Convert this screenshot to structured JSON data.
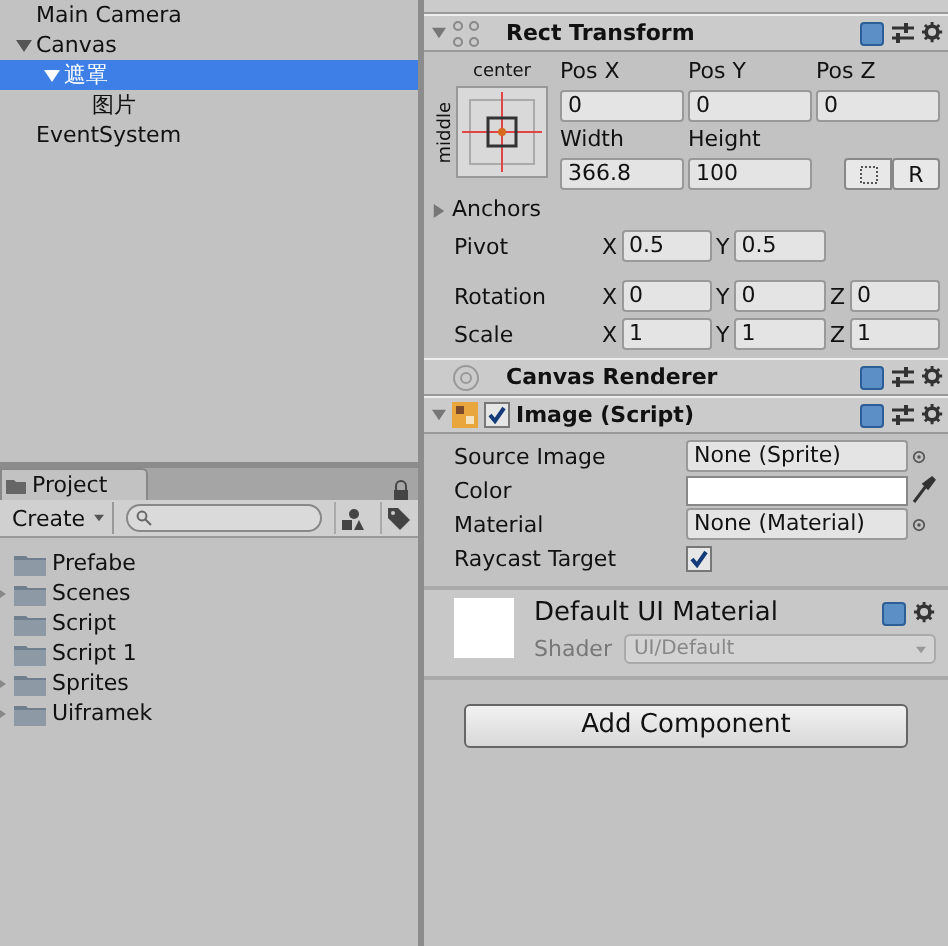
{
  "hierarchy": {
    "items": [
      {
        "label": "Main Camera",
        "selected": false
      },
      {
        "label": "Canvas",
        "selected": false,
        "expanded": true,
        "children": [
          {
            "label": "遮罩",
            "selected": true,
            "expanded": true,
            "children": [
              {
                "label": "图片",
                "selected": false
              }
            ]
          }
        ]
      },
      {
        "label": "EventSystem",
        "selected": false
      }
    ]
  },
  "project": {
    "tab": "Project",
    "create": "Create",
    "folders": [
      {
        "label": "Prefabe",
        "expandable": false
      },
      {
        "label": "Scenes",
        "expandable": true
      },
      {
        "label": "Script",
        "expandable": false
      },
      {
        "label": "Script 1",
        "expandable": false
      },
      {
        "label": "Sprites",
        "expandable": true
      },
      {
        "label": "Uiframek",
        "expandable": true
      }
    ]
  },
  "inspector": {
    "rect_transform": {
      "title": "Rect Transform",
      "expanded": true,
      "anchor_horizontal": "center",
      "anchor_vertical": "middle",
      "position_labels": [
        "Pos X",
        "Pos Y",
        "Pos Z"
      ],
      "position_values": [
        "0",
        "0",
        "0"
      ],
      "size_labels": [
        "Width",
        "Height"
      ],
      "size_values": [
        "366.8",
        "100"
      ],
      "raw_button": "R",
      "anchors": {
        "label": "Anchors",
        "expanded": false
      },
      "vectors": [
        {
          "label": "Pivot",
          "fields": [
            {
              "axis": "X",
              "value": "0.5"
            },
            {
              "axis": "Y",
              "value": "0.5"
            }
          ]
        },
        {
          "label": "Rotation",
          "fields": [
            {
              "axis": "X",
              "value": "0"
            },
            {
              "axis": "Y",
              "value": "0"
            },
            {
              "axis": "Z",
              "value": "0"
            }
          ]
        },
        {
          "label": "Scale",
          "fields": [
            {
              "axis": "X",
              "value": "1"
            },
            {
              "axis": "Y",
              "value": "1"
            },
            {
              "axis": "Z",
              "value": "1"
            }
          ]
        }
      ]
    },
    "canvas_renderer": {
      "title": "Canvas Renderer"
    },
    "image_script": {
      "title": "Image (Script)",
      "enabled": true,
      "expanded": true,
      "properties": [
        {
          "kind": "object",
          "label": "Source Image",
          "value": "None (Sprite)"
        },
        {
          "kind": "color",
          "label": "Color",
          "color": "#ffffff"
        },
        {
          "kind": "object",
          "label": "Material",
          "value": "None (Material)"
        },
        {
          "kind": "toggle",
          "label": "Raycast Target",
          "checked": true
        }
      ]
    },
    "material": {
      "title": "Default UI Material",
      "shader_label": "Shader",
      "shader": "UI/Default"
    },
    "add_component": "Add Component"
  }
}
